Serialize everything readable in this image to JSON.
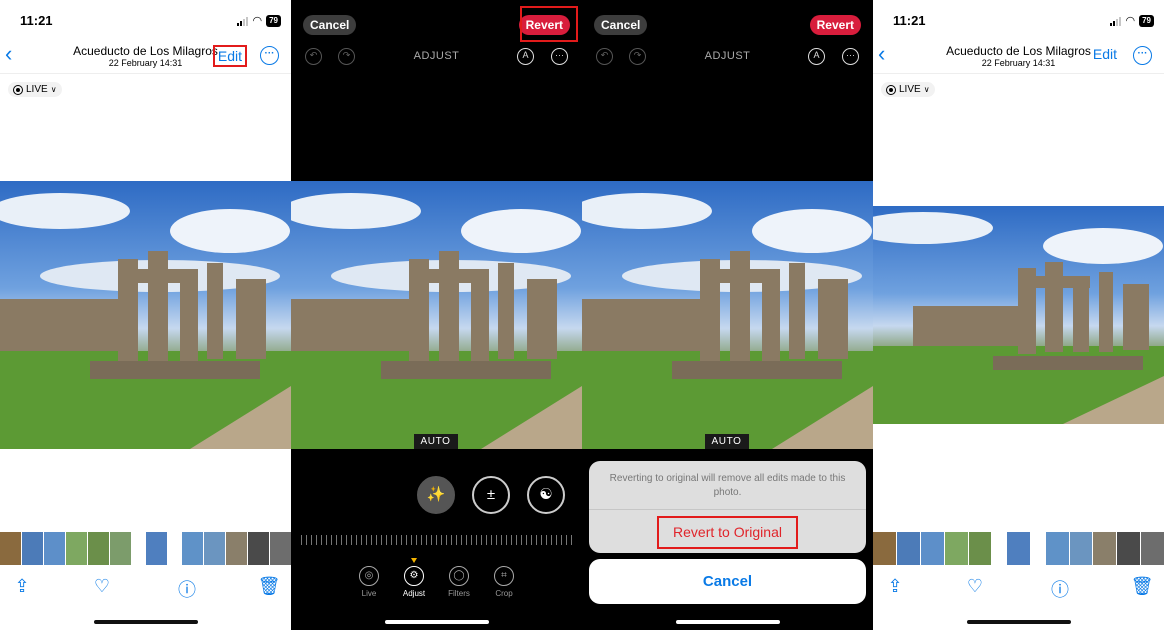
{
  "status": {
    "time": "11:21",
    "battery": "79"
  },
  "photo_view": {
    "title": "Acueducto de Los Milagros",
    "subtitle": "22 February  14:31",
    "edit_label": "Edit",
    "live_label": "LIVE"
  },
  "edit_view": {
    "cancel_label": "Cancel",
    "revert_label": "Revert",
    "mode_label": "ADJUST",
    "auto_label": "AUTO",
    "tabs": [
      {
        "label": "Live"
      },
      {
        "label": "Adjust"
      },
      {
        "label": "Filters"
      },
      {
        "label": "Crop"
      }
    ]
  },
  "revert_sheet": {
    "message": "Reverting to original will remove all edits made to this photo.",
    "revert_original_label": "Revert to Original",
    "cancel_label": "Cancel"
  },
  "colors": {
    "accent": "#0a7ae6",
    "revert": "#d81d3c",
    "highlight_box": "#e21b1b"
  },
  "icons": [
    "back-chevron-icon",
    "more-icon",
    "live-icon",
    "share-icon",
    "heart-icon",
    "info-sparkle-icon",
    "trash-icon",
    "undo-icon",
    "redo-icon",
    "markup-icon",
    "magic-wand-icon",
    "exposure-icon",
    "brilliance-icon"
  ]
}
